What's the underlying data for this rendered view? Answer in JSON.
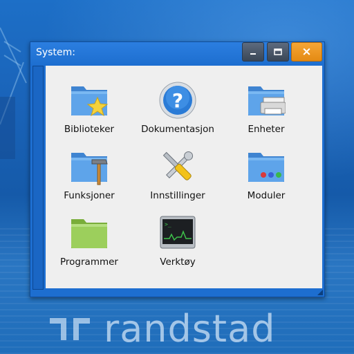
{
  "window": {
    "title": "System:",
    "buttons": {
      "minimize_icon": "minimize-icon",
      "maximize_icon": "maximize-icon",
      "close_icon": "close-icon",
      "close_glyph": "×"
    },
    "items": [
      {
        "label": "Biblioteker",
        "icon": "folder-star-icon"
      },
      {
        "label": "Dokumentasjon",
        "icon": "help-icon"
      },
      {
        "label": "Enheter",
        "icon": "folder-printer-icon"
      },
      {
        "label": "Funksjoner",
        "icon": "folder-hammer-icon"
      },
      {
        "label": "Innstillinger",
        "icon": "tools-icon"
      },
      {
        "label": "Moduler",
        "icon": "folder-modules-icon"
      },
      {
        "label": "Programmer",
        "icon": "folder-green-icon"
      },
      {
        "label": "Verktøy",
        "icon": "system-monitor-icon"
      }
    ]
  },
  "desktop": {
    "brand_name": "randstad"
  },
  "colors": {
    "titlebar": "#1e6fd0",
    "close_button": "#e48a13",
    "content_bg": "#efefef",
    "folder_blue": "#4a90d9",
    "folder_green": "#8cc24a"
  }
}
